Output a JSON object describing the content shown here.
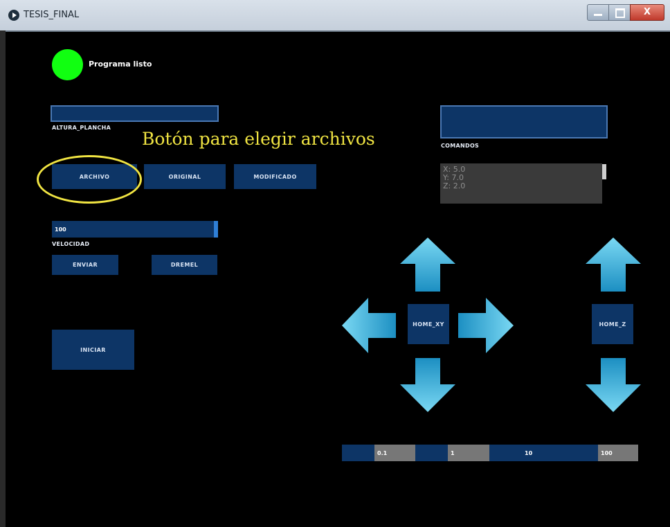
{
  "window": {
    "title": "TESIS_FINAL",
    "close_label": "X"
  },
  "status": {
    "text": "Programa listo",
    "color": "#11ff11"
  },
  "altura": {
    "label": "ALTURA_PLANCHA",
    "value": ""
  },
  "annotation": {
    "text": "Botón para elegir archivos",
    "color": "#f0e442"
  },
  "file_buttons": {
    "archivo": "ARCHIVO",
    "original": "ORIGINAL",
    "modificado": "MODIFICADO"
  },
  "comandos": {
    "label": "COMANDOS",
    "value": ""
  },
  "console": {
    "lines": [
      "X: 5.0",
      "Y: 7.0",
      "Z: 2.0"
    ]
  },
  "velocidad": {
    "label": "VELOCIDAD",
    "value": "100",
    "fraction": 1.0
  },
  "action_buttons": {
    "enviar": "ENVIAR",
    "dremel": "DREMEL",
    "iniciar": "INICIAR"
  },
  "jog": {
    "home_xy": "HOME_XY",
    "home_z": "HOME_Z"
  },
  "steps": [
    "0.1",
    "1",
    "10",
    "100"
  ],
  "colors": {
    "background": "#000000",
    "button": "#0d3566",
    "arrow": "#29b6df"
  },
  "icons": [
    "play-icon",
    "arrow-up-icon",
    "arrow-down-icon",
    "arrow-left-icon",
    "arrow-right-icon"
  ]
}
